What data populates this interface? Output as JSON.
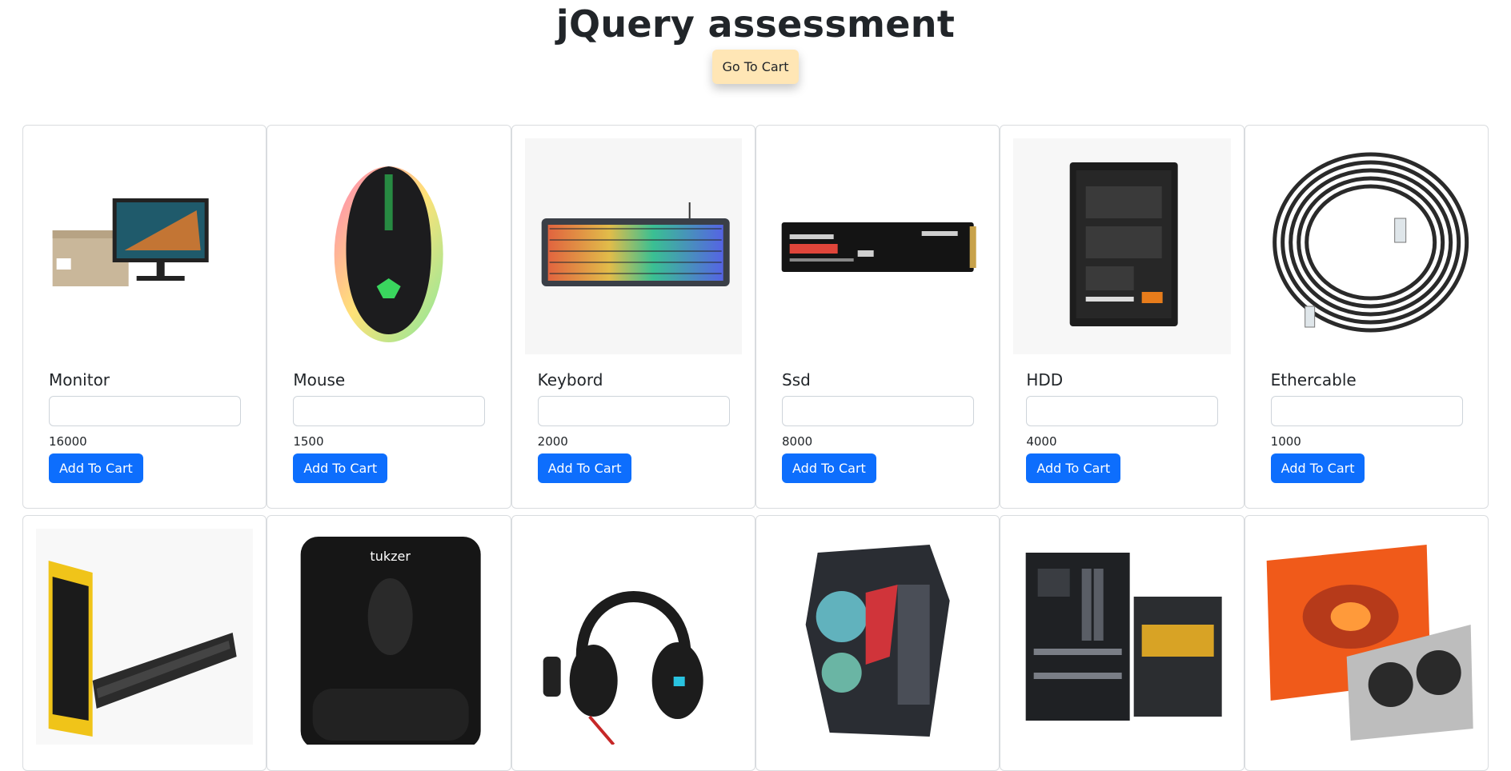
{
  "header": {
    "title": "jQuery assessment",
    "cart_button_label": "Go To Cart"
  },
  "colors": {
    "primary_button": "#0d6efd",
    "cart_button": "#ffe6b5"
  },
  "products": [
    {
      "name": "Monitor",
      "price": "16000",
      "add_label": "Add To Cart",
      "quantity": "",
      "image_icon": "monitor-image"
    },
    {
      "name": "Mouse",
      "price": "1500",
      "add_label": "Add To Cart",
      "quantity": "",
      "image_icon": "gaming-mouse-image"
    },
    {
      "name": "Keybord",
      "price": "2000",
      "add_label": "Add To Cart",
      "quantity": "",
      "image_icon": "rgb-keyboard-image"
    },
    {
      "name": "Ssd",
      "price": "8000",
      "add_label": "Add To Cart",
      "quantity": "",
      "image_icon": "nvme-ssd-image"
    },
    {
      "name": "HDD",
      "price": "4000",
      "add_label": "Add To Cart",
      "quantity": "",
      "image_icon": "hard-drive-image"
    },
    {
      "name": "Ethercable",
      "price": "1000",
      "add_label": "Add To Cart",
      "quantity": "",
      "image_icon": "ethernet-cable-image"
    }
  ],
  "products_row2": [
    {
      "image_icon": "ram-memory-image"
    },
    {
      "image_icon": "mouse-pad-image",
      "brand_text": "tukzer"
    },
    {
      "image_icon": "headset-image"
    },
    {
      "image_icon": "pc-case-image"
    },
    {
      "image_icon": "motherboard-image"
    },
    {
      "image_icon": "graphics-card-image"
    }
  ]
}
